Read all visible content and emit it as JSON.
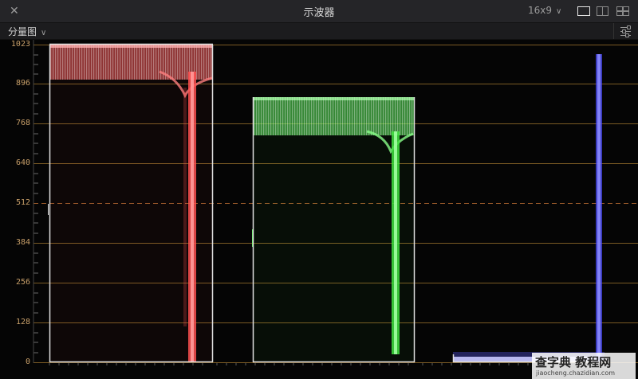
{
  "window": {
    "title": "示波器",
    "close_icon": "close-icon"
  },
  "header": {
    "aspect_value": "16x9",
    "aspect_chevron": "∨",
    "views": [
      "single-view-icon",
      "dual-view-icon",
      "quad-view-icon"
    ]
  },
  "toolbar": {
    "mode_value": "分量图",
    "mode_chevron": "∨",
    "settings_icon": "settings-sliders-icon"
  },
  "scope": {
    "y_ticks": [
      "1023",
      "896",
      "768",
      "640",
      "512",
      "384",
      "256",
      "128",
      "0"
    ],
    "midline_value": "512",
    "colors": {
      "red": "#ff5a5a",
      "green": "#5cf25c",
      "blue": "#5a5aff",
      "grid": "#7a5a24",
      "labels": "#c9a06a",
      "border": "#e0e0e0"
    }
  },
  "watermark": {
    "line1": "查字典 教程网",
    "line2": "jiaocheng.chazidian.com"
  }
}
